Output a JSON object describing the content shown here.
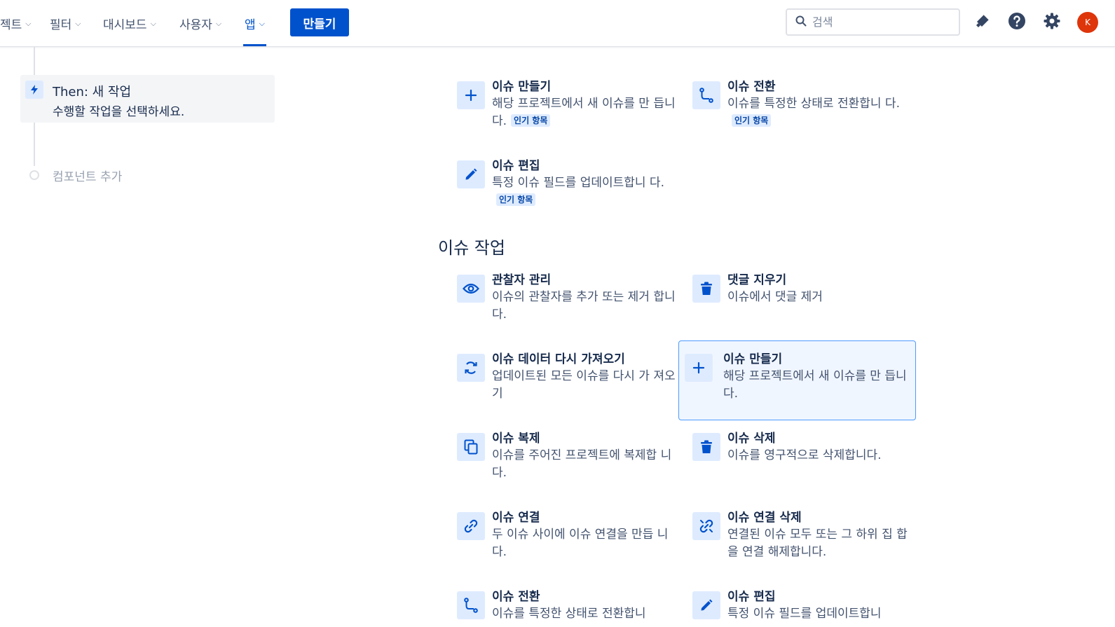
{
  "nav": {
    "items": [
      {
        "label": "젝트"
      },
      {
        "label": "필터"
      },
      {
        "label": "대시보드"
      },
      {
        "label": "사용자"
      },
      {
        "label": "앱"
      }
    ],
    "create_label": "만들기",
    "search_placeholder": "검색",
    "avatar_initial": "K",
    "accent_color": "#0052cc"
  },
  "rule": {
    "then_title": "Then: 새 작업",
    "then_subtitle": "수행할 작업을 선택하세요.",
    "add_component": "컴포넌트 추가"
  },
  "popular": {
    "cards": [
      {
        "title": "이슈 만들기",
        "desc": "해당 프로젝트에서 새 이슈를 만 듭니다.",
        "badge": "인기 항목",
        "icon": "plus-icon"
      },
      {
        "title": "이슈 전환",
        "desc": "이슈를 특정한 상태로 전환합니 다.",
        "badge": "인기 항목",
        "icon": "transition-icon"
      },
      {
        "title": "이슈 편집",
        "desc": "특정 이슈 필드를 업데이트합니 다.",
        "badge": "인기 항목",
        "icon": "pencil-icon"
      }
    ]
  },
  "issue_actions": {
    "heading": "이슈 작업",
    "cards": [
      {
        "title": "관찰자 관리",
        "desc": "이슈의 관찰자를 추가 또는 제거 합니다.",
        "icon": "eye-icon"
      },
      {
        "title": "댓글 지우기",
        "desc": "이슈에서 댓글 제거",
        "icon": "trash-icon"
      },
      {
        "title": "이슈 데이터 다시 가져오기",
        "desc": "업데이트된 모든 이슈를 다시 가 져오기",
        "icon": "refresh-icon"
      },
      {
        "title": "이슈 만들기",
        "desc": "해당 프로젝트에서 새 이슈를 만 듭니다.",
        "icon": "plus-icon"
      },
      {
        "title": "이슈 복제",
        "desc": "이슈를 주어진 프로젝트에 복제합 니다.",
        "icon": "copy-icon"
      },
      {
        "title": "이슈 삭제",
        "desc": "이슈를 영구적으로 삭제합니다.",
        "icon": "trash-icon"
      },
      {
        "title": "이슈 연결",
        "desc": "두 이슈 사이에 이슈 연결을 만듭 니다.",
        "icon": "link-icon"
      },
      {
        "title": "이슈 연결 삭제",
        "desc": "연결된 이슈 모두 또는 그 하위 집 합을 연결 해제합니다.",
        "icon": "unlink-icon"
      },
      {
        "title": "이슈 전환",
        "desc": "이슈를 특정한 상태로 전환합니",
        "icon": "transition-icon"
      },
      {
        "title": "이슈 편집",
        "desc": "특정 이슈 필드를 업데이트합니",
        "icon": "pencil-icon"
      }
    ]
  }
}
